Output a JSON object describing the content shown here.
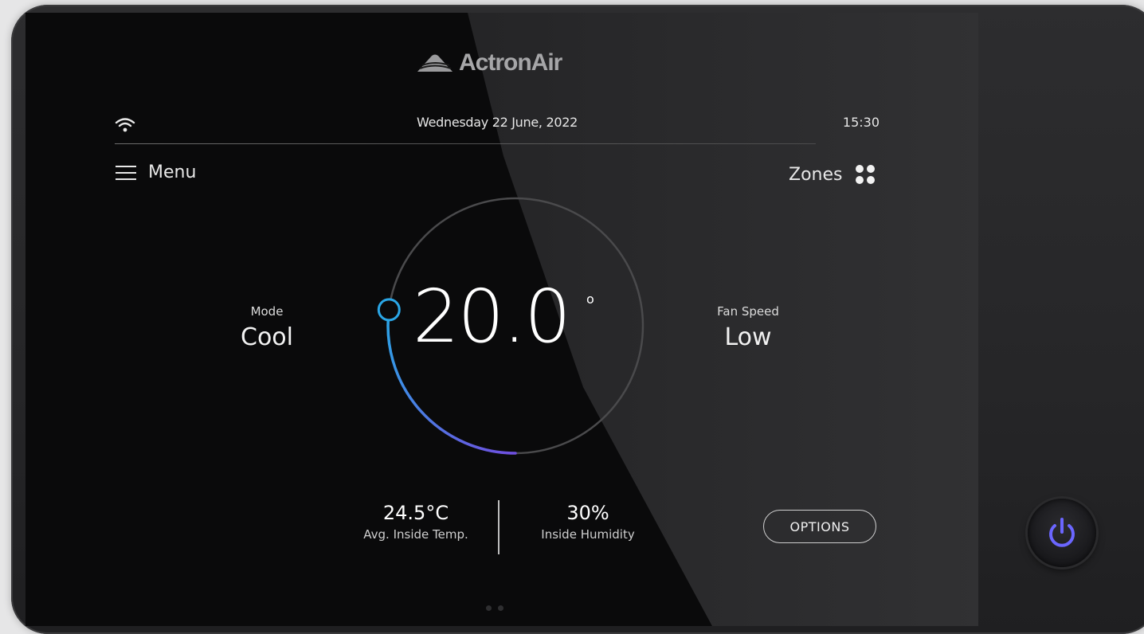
{
  "brand": {
    "name": "ActronAir"
  },
  "status_bar": {
    "date": "Wednesday 22 June, 2022",
    "time": "15:30",
    "wifi_icon": "wifi-icon"
  },
  "nav": {
    "menu_label": "Menu",
    "zones_label": "Zones"
  },
  "thermostat": {
    "setpoint": "20.0",
    "degree_symbol": "o",
    "dial_fill_fraction": 0.27
  },
  "mode": {
    "label": "Mode",
    "value": "Cool"
  },
  "fan_speed": {
    "label": "Fan Speed",
    "value": "Low"
  },
  "stats": {
    "avg_temp_value": "24.5°C",
    "avg_temp_label": "Avg. Inside Temp.",
    "humidity_value": "30%",
    "humidity_label": "Inside Humidity"
  },
  "options_label": "OPTIONS",
  "colors": {
    "accent_blue": "#2aa6e6",
    "accent_purple": "#6f4fe0",
    "power_icon": "#6b66ff"
  }
}
